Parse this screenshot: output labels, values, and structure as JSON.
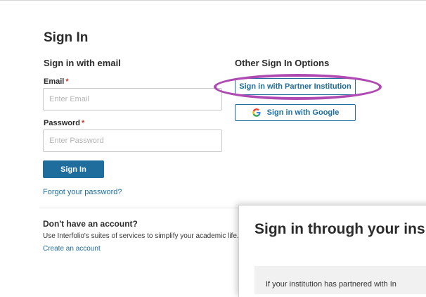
{
  "page": {
    "title": "Sign In"
  },
  "email_section": {
    "heading": "Sign in with email",
    "email_label": "Email",
    "email_required": "*",
    "email_placeholder": "Enter Email",
    "password_label": "Password",
    "password_required": "*",
    "password_placeholder": "Enter Password",
    "sign_in_label": "Sign In",
    "forgot_link": "Forgot your password?"
  },
  "other_options": {
    "heading": "Other Sign In Options",
    "partner_button": "Sign in with Partner Institution",
    "google_button": "Sign in with Google"
  },
  "account": {
    "heading": "Don't have an account?",
    "description": "Use Interfolio's suites of services to simplify your academic life.",
    "create_link": "Create an account"
  },
  "overlay": {
    "title": "Sign in through your ins",
    "info": "If your institution has partnered with In"
  },
  "colors": {
    "accent": "#1f6d9c",
    "highlight": "#b04ab3",
    "required": "#c0392b"
  },
  "icons": {
    "google": "google-icon"
  }
}
